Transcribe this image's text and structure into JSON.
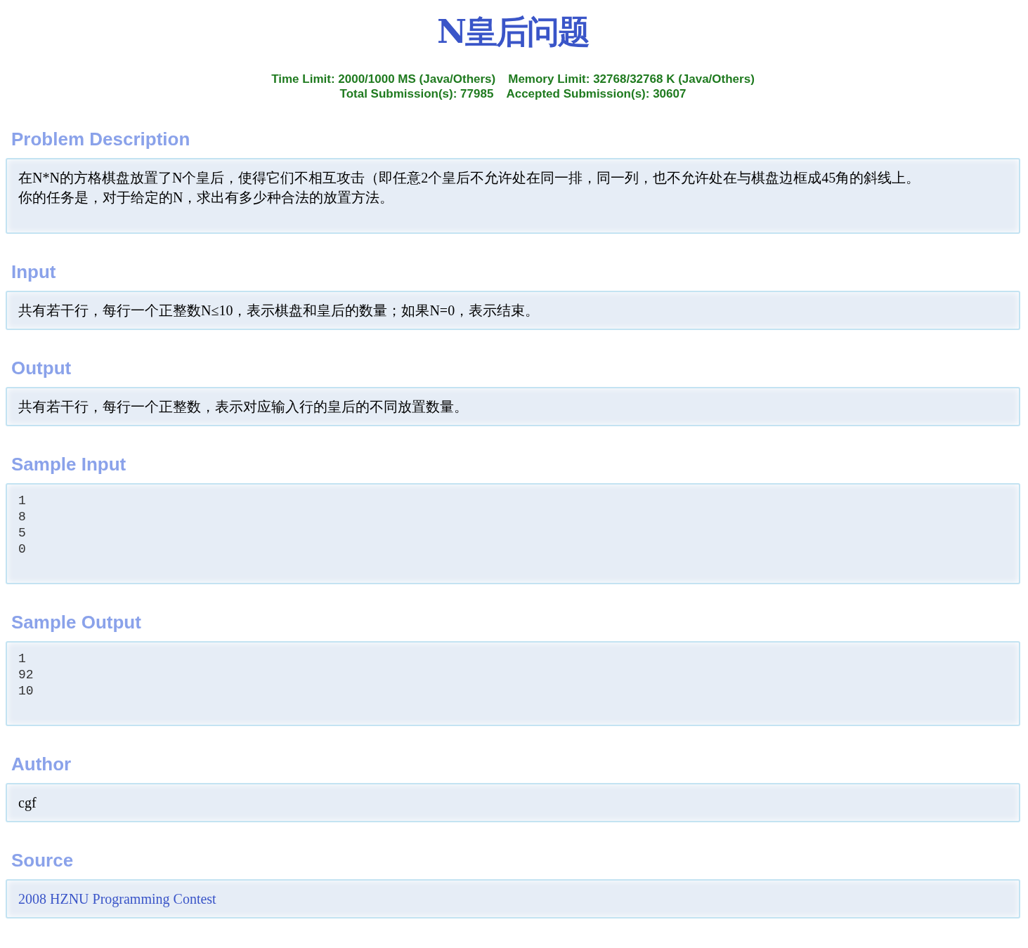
{
  "title": "N皇后问题",
  "limits": [
    "Time Limit: 2000/1000 MS (Java/Others)",
    "Memory Limit: 32768/32768 K (Java/Others)"
  ],
  "submissions": [
    "Total Submission(s): 77985",
    "Accepted Submission(s): 30607"
  ],
  "sections": [
    {
      "heading": "Problem Description",
      "kind": "text",
      "lines": [
        "在N*N的方格棋盘放置了N个皇后，使得它们不相互攻击（即任意2个皇后不允许处在同一排，同一列，也不允许处在与棋盘边框成45角的斜线上。",
        "你的任务是，对于给定的N，求出有多少种合法的放置方法。"
      ]
    },
    {
      "heading": "Input",
      "kind": "text",
      "lines": [
        "共有若干行，每行一个正整数N≤10，表示棋盘和皇后的数量；如果N=0，表示结束。"
      ]
    },
    {
      "heading": "Output",
      "kind": "text",
      "lines": [
        "共有若干行，每行一个正整数，表示对应输入行的皇后的不同放置数量。"
      ]
    },
    {
      "heading": "Sample Input",
      "kind": "code",
      "lines": [
        "1",
        "8",
        "5",
        "0"
      ]
    },
    {
      "heading": "Sample Output",
      "kind": "code",
      "lines": [
        "1",
        "92",
        "10"
      ]
    },
    {
      "heading": "Author",
      "kind": "text",
      "lines": [
        "cgf"
      ]
    },
    {
      "heading": "Source",
      "kind": "link",
      "lines": [
        "2008 HZNU Programming Contest"
      ]
    }
  ]
}
